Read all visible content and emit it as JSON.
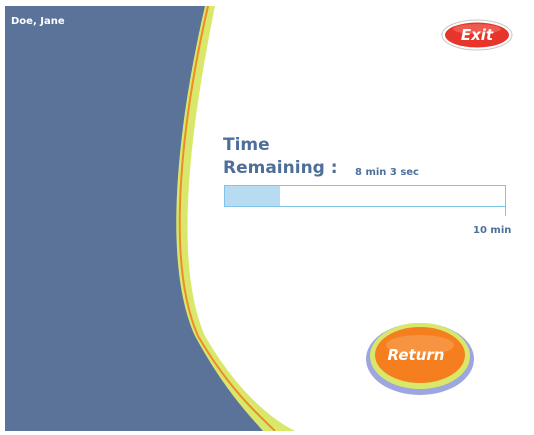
{
  "user": {
    "name": "Doe, Jane"
  },
  "exit_button": {
    "label": "Exit",
    "icon": "exit-pill-icon"
  },
  "timer": {
    "title_line1": "Time",
    "title_line2": "Remaining :",
    "remaining": "8 min 3 sec",
    "max_label": "10 min",
    "progress_fraction": 0.195
  },
  "return_button": {
    "label": "Return",
    "icon": "arrow-right-icon"
  },
  "colors": {
    "panel_blue": "#5b7399",
    "accent_yellow": "#d9e86b",
    "accent_orange": "#f08a2a",
    "text_blue": "#4f6f9a",
    "progress_border": "#7fc4e6",
    "progress_fill": "#b7dcf2",
    "exit_red": "#e8352b",
    "return_orange": "#f57f1f"
  }
}
